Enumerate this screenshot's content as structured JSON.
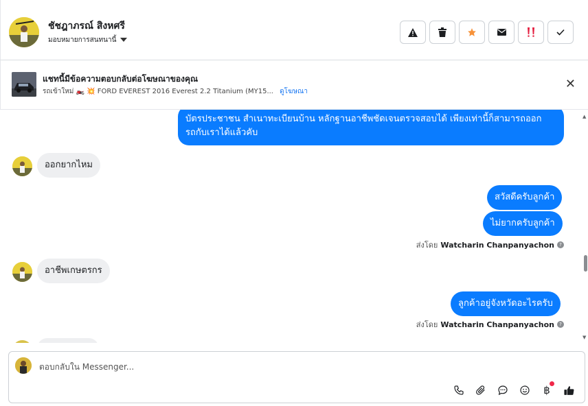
{
  "header": {
    "name": "ชัชฎาภรณ์ สิงหศรี",
    "assign_label": "มอบหมายการสนทนานี้",
    "actions": [
      "warning-icon",
      "trash-icon",
      "star-icon",
      "mail-icon",
      "double-exclamation-icon",
      "check-icon"
    ],
    "colors": {
      "star": "#f7923a",
      "exclaim": "#e41e3f"
    }
  },
  "ad": {
    "title": "แชทนี้มีข้อความตอบกลับต่อโฆษณาของคุณ",
    "subtitle": "รถเข้าใหม่ 🏍️ 💥 FORD EVEREST 2016 Everest 2.2 Titanium (MY15...",
    "link": "ดูโฆษณา"
  },
  "thread": {
    "messages": [
      {
        "dir": "out",
        "text_line1": "บัตรประชาชน สำเนาทะเบียนบ้าน หลักฐานอาชีพชัดเจนตรวจสอบได้ เพียงเท่านี้ก็สามารถออก",
        "text_line2": "รถกับเราได้แล้วคับ"
      },
      {
        "dir": "in",
        "text": "ออกยากไหม"
      },
      {
        "dir": "out",
        "text": "สวัสดีครับลูกค้า"
      },
      {
        "dir": "out",
        "text": "ไม่ยากครับลูกค้า"
      },
      {
        "dir": "in",
        "text": "อาชีพเกษตรกร"
      },
      {
        "dir": "out",
        "text": "ลูกค้าอยู่จังหวัดอะไรครับ"
      }
    ],
    "sent_by_prefix": "ส่งโดย",
    "sent_by_name": "Watcharin Chanpanyachon"
  },
  "composer": {
    "placeholder": "ตอบกลับใน Messenger...",
    "tools": [
      "phone-icon",
      "paperclip-icon",
      "chat-bubble-icon",
      "smiley-icon",
      "baht-icon",
      "thumbs-up-icon"
    ],
    "accent": "#0a7cff"
  }
}
